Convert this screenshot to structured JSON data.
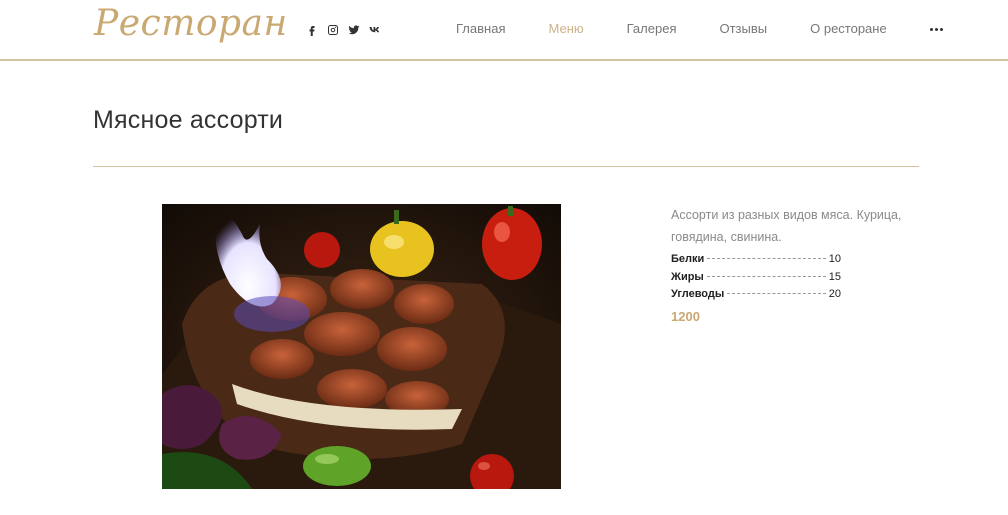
{
  "header": {
    "logo": "Ресторан",
    "social": [
      {
        "icon": "facebook-icon"
      },
      {
        "icon": "instagram-icon"
      },
      {
        "icon": "twitter-icon"
      },
      {
        "icon": "vk-icon"
      }
    ],
    "nav": [
      {
        "label": "Главная",
        "active": false
      },
      {
        "label": "Меню",
        "active": true
      },
      {
        "label": "Галерея",
        "active": false
      },
      {
        "label": "Отзывы",
        "active": false
      },
      {
        "label": "О ресторане",
        "active": false
      }
    ],
    "more_icon": "more-dots-icon"
  },
  "dish": {
    "title": "Мясное ассорти",
    "description": "Ассорти из разных видов мяса. Курица, говядина, свинина.",
    "nutrition": [
      {
        "name": "Белки",
        "value": "10"
      },
      {
        "name": "Жиры",
        "value": "15"
      },
      {
        "name": "Углеводы",
        "value": "20"
      }
    ],
    "price": "1200"
  },
  "colors": {
    "accent": "#c9a871",
    "divider": "#d4c19e",
    "active_nav": "#cdb28a"
  }
}
